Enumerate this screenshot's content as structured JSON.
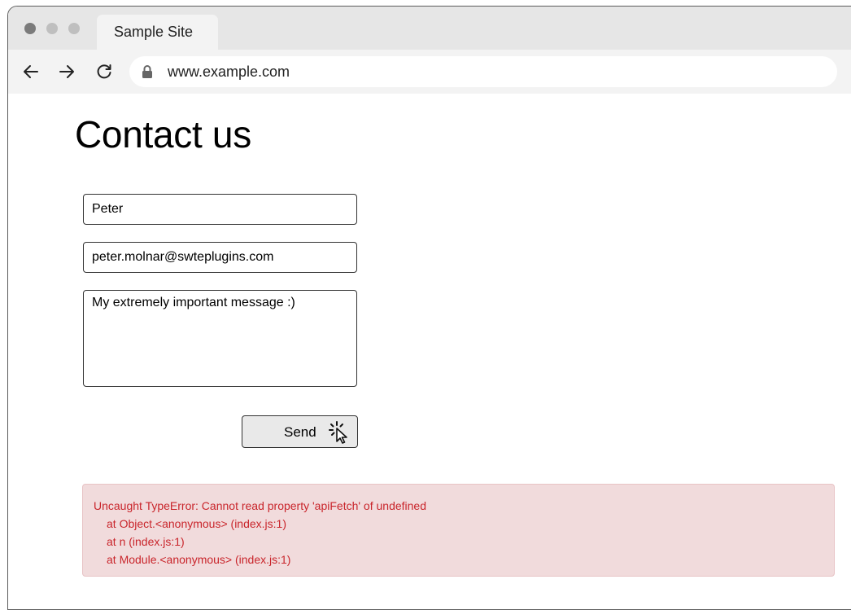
{
  "browser": {
    "tab_title": "Sample Site",
    "url": "www.example.com"
  },
  "page": {
    "title": "Contact us",
    "form": {
      "name_value": "Peter",
      "email_value": "peter.molnar@swteplugins.com",
      "message_value": "My extremely important message :)",
      "send_label": "Send"
    },
    "error": {
      "lines": [
        "Uncaught TypeError: Cannot read property 'apiFetch' of undefined",
        "at Object.<anonymous> (index.js:1)",
        "at n (index.js:1)",
        "at Module.<anonymous> (index.js:1)"
      ]
    }
  },
  "colors": {
    "error_text": "#c9252b",
    "error_background": "#f1dbdc",
    "button_background": "#e9e9e9"
  }
}
